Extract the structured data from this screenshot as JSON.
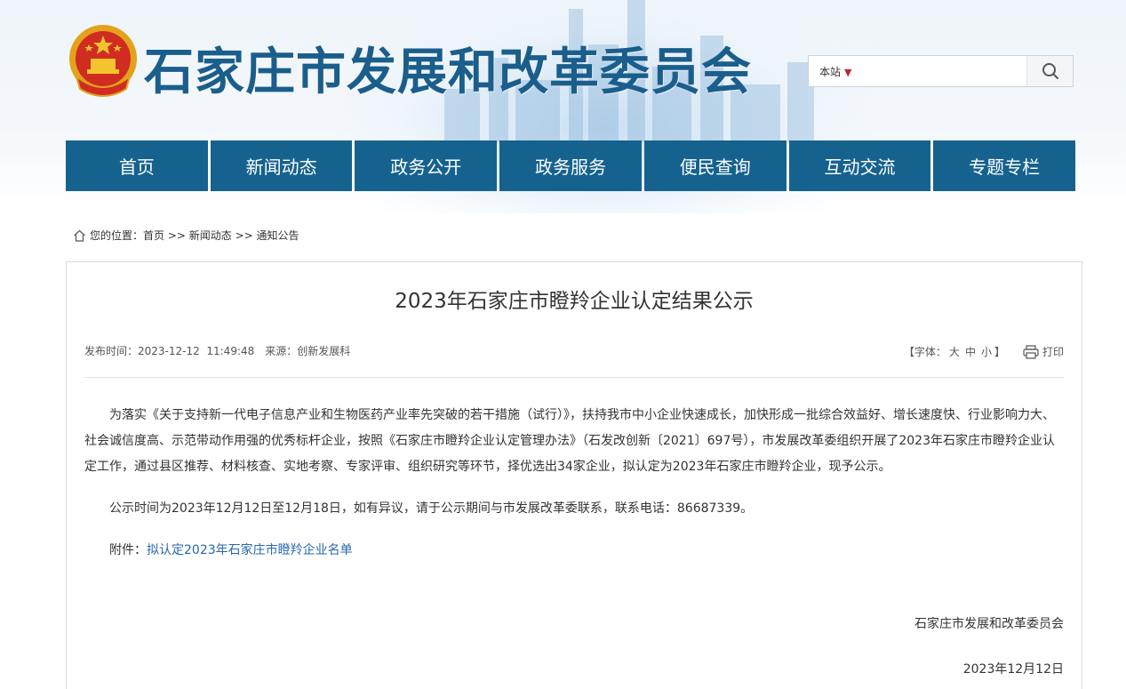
{
  "header": {
    "site_title": "石家庄市发展和改革委员会",
    "search_scope": "本站",
    "search_placeholder": "",
    "search_icon": "search-icon"
  },
  "nav": {
    "items": [
      "首页",
      "新闻动态",
      "政务公开",
      "政务服务",
      "便民查询",
      "互动交流",
      "专题专栏"
    ]
  },
  "breadcrumb": {
    "label": "您的位置：",
    "path": [
      "首页",
      "新闻动态",
      "通知公告"
    ],
    "separator": " >> "
  },
  "article": {
    "title": "2023年石家庄市瞪羚企业认定结果公示",
    "publish_time": "发布时间：2023-12-12  11:49:48",
    "source": "来源：创新发展科",
    "font_label_open": "【字体：",
    "font_sizes": [
      "大",
      "中",
      "小"
    ],
    "font_label_close": "】",
    "print_label": "打印",
    "paragraph_1": "为落实《关于支持新一代电子信息产业和生物医药产业率先突破的若干措施（试行）》，扶持我市中小企业快速成长，加快形成一批综合效益好、增长速度快、行业影响力大、社会诚信度高、示范带动作用强的优秀标杆企业，按照《石家庄市瞪羚企业认定管理办法》（石发改创新〔2021〕697号），市发展改革委组织开展了2023年石家庄市瞪羚企业认定工作，通过县区推荐、材料核查、实地考察、专家评审、组织研究等环节，择优选出34家企业，拟认定为2023年石家庄市瞪羚企业，现予公示。",
    "paragraph_2": "公示时间为2023年12月12日至12月18日，如有异议，请于公示期间与市发展改革委联系，联系电话：86687339。",
    "attachment_label": "附件：",
    "attachment_link": "拟认定2023年石家庄市瞪羚企业名单",
    "signature": "石家庄市发展和改革委员会",
    "date": "2023年12月12日"
  },
  "colors": {
    "nav_bg": "#16628f",
    "title_blue": "#1a5e8c",
    "link": "#2767b1",
    "caret_red": "#c0272d"
  }
}
